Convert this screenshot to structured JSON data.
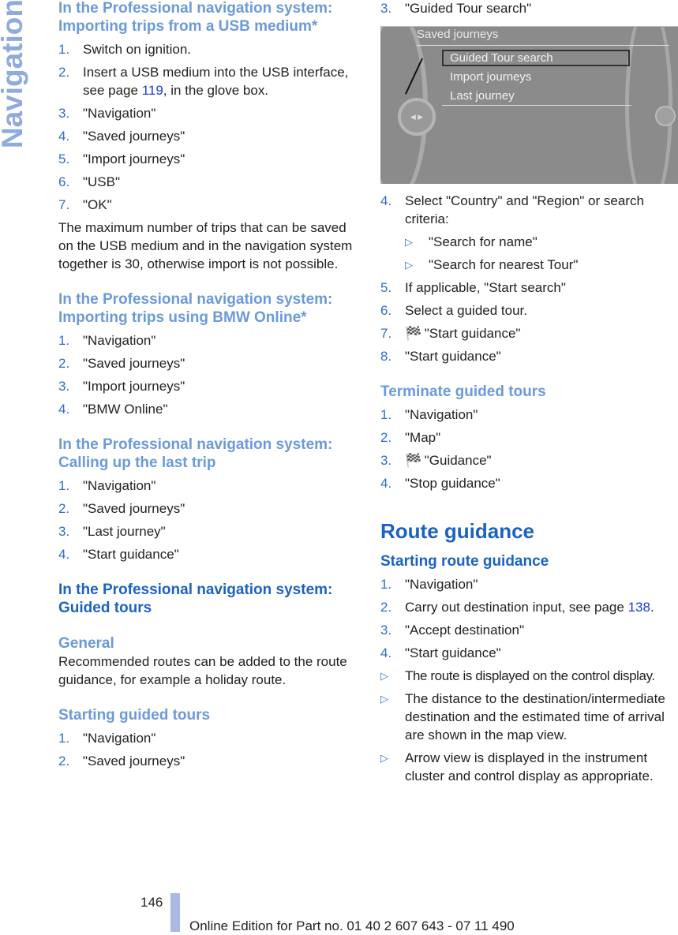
{
  "side_tab": "Navigation",
  "left": {
    "s1": {
      "heading": "In the Professional navigation system: Importing trips from a USB medium*",
      "items": [
        "Switch on ignition.",
        "Insert a USB medium into the USB interface, see page ",
        "\"Navigation\"",
        "\"Saved journeys\"",
        "\"Import journeys\"",
        "\"USB\"",
        "\"OK\""
      ],
      "item2_link": "119",
      "item2_after": ", in the glove box.",
      "note": "The maximum number of trips that can be saved on the USB medium and in the navigation system together is 30, otherwise import is not possible."
    },
    "s2": {
      "heading": "In the Professional navigation system: Importing trips using BMW Online*",
      "items": [
        "\"Navigation\"",
        "\"Saved journeys\"",
        "\"Import journeys\"",
        "\"BMW Online\""
      ]
    },
    "s3": {
      "heading": "In the Professional navigation system: Calling up the last trip",
      "items": [
        "\"Navigation\"",
        "\"Saved journeys\"",
        "\"Last journey\"",
        "\"Start guidance\""
      ]
    },
    "s4": {
      "heading": "In the Professional navigation system: Guided tours"
    },
    "s5": {
      "heading": "General",
      "text": "Recommended routes can be added to the route guidance, for example a holiday route."
    },
    "s6": {
      "heading": "Starting guided tours",
      "items": [
        "\"Navigation\"",
        "\"Saved journeys\""
      ]
    }
  },
  "right": {
    "item3": "\"Guided Tour search\"",
    "screen": {
      "title": "Saved journeys",
      "menu": [
        "Guided Tour search",
        "Import journeys",
        "Last journey"
      ]
    },
    "items_after": [
      "Select \"Country\" and \"Region\" or search criteria:",
      "If applicable, \"Start search\"",
      "Select a guided tour.",
      "\"Start guidance\"",
      "\"Start guidance\""
    ],
    "sub_items": [
      "\"Search for name\"",
      "\"Search for nearest Tour\""
    ],
    "terminate": {
      "heading": "Terminate guided tours",
      "items": [
        "\"Navigation\"",
        "\"Map\"",
        "\"Guidance\"",
        "\"Stop guidance\""
      ]
    },
    "route": {
      "title": "Route guidance",
      "heading": "Starting route guidance",
      "items": [
        "\"Navigation\"",
        "Carry out destination input, see page ",
        "\"Accept destination\"",
        "\"Start guidance\""
      ],
      "item2_link": "138",
      "item2_after": ".",
      "bullets": [
        "The route is displayed on the control display.",
        "The distance to the destination/intermediate destination and the estimated time of arrival are shown in the map view.",
        "Arrow view is displayed in the instrument cluster and control display as appropriate."
      ]
    }
  },
  "footer": {
    "page": "146",
    "edition": "Online Edition for Part no. 01 40 2 607 643 - 07 11 490"
  },
  "colors": {
    "heading_light": "#6b9ad9",
    "heading_dark": "#1c62c2",
    "link": "#1a3fd0",
    "side_tab": "#8faadc"
  }
}
